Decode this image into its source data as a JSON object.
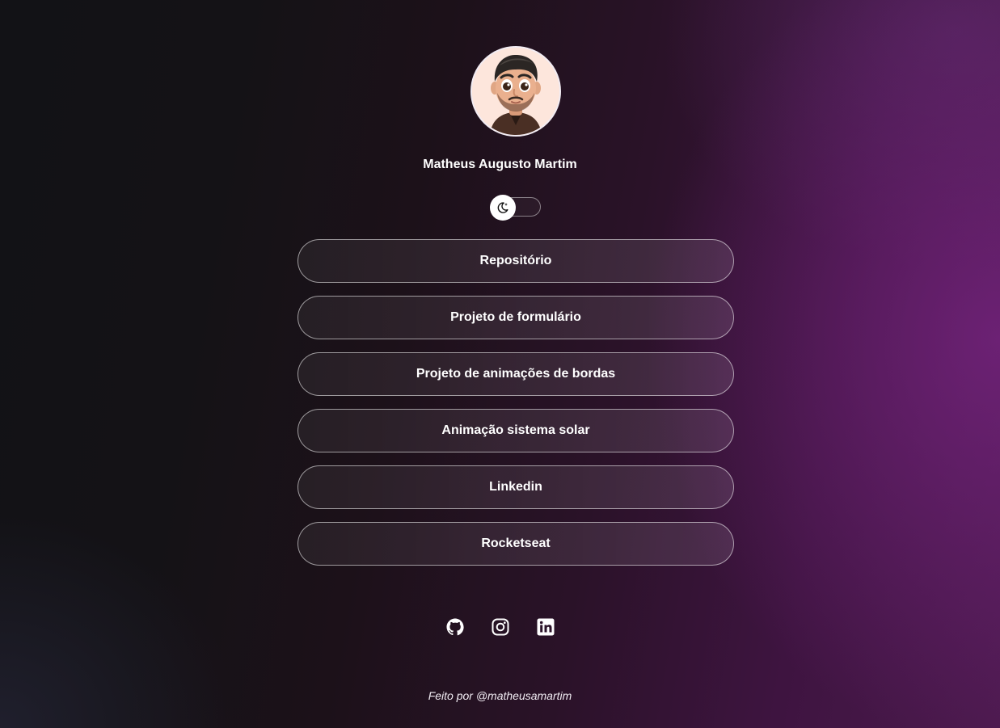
{
  "profile": {
    "avatar_icon": "memoji-avatar",
    "name": "Matheus Augusto Martim"
  },
  "theme_switch": {
    "icon": "moon-stars-icon",
    "state": "dark"
  },
  "links": [
    {
      "label": "Repositório"
    },
    {
      "label": "Projeto de formulário"
    },
    {
      "label": "Projeto de animações de bordas"
    },
    {
      "label": "Animação sistema solar"
    },
    {
      "label": "Linkedin"
    },
    {
      "label": "Rocketseat"
    }
  ],
  "socials": [
    {
      "icon": "github-icon"
    },
    {
      "icon": "instagram-icon"
    },
    {
      "icon": "linkedin-icon"
    }
  ],
  "footer": {
    "text": "Feito por @matheusamartim"
  },
  "colors": {
    "background_dark": "#121216",
    "background_accent": "#5c1f62",
    "text": "#ffffff"
  }
}
